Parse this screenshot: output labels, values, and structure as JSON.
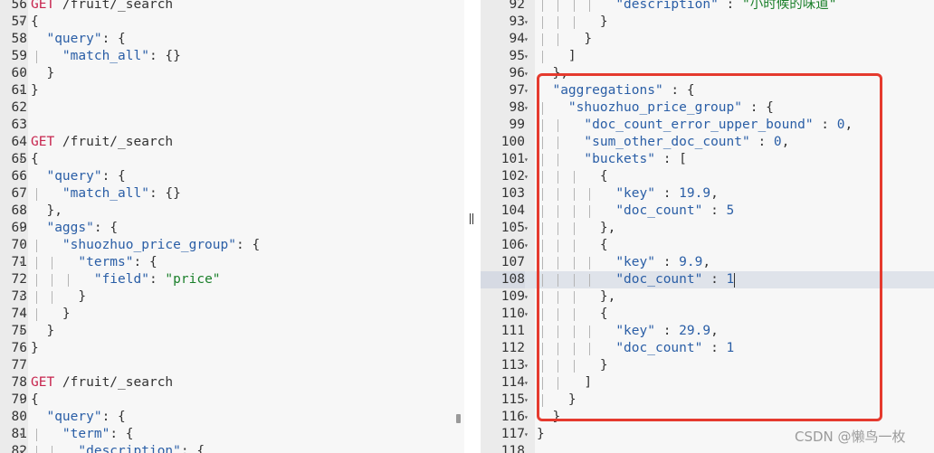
{
  "colors": {
    "annotation_box": "#e53a2e",
    "method": "#c7254e",
    "key": "#2a5ea6",
    "string": "#1a7f2a",
    "number": "#2a5ea6",
    "active_line": "#dfe3ea"
  },
  "watermark": "CSDN @懒鸟一枚",
  "left_editor": {
    "lines": [
      {
        "n": "56",
        "fold": false,
        "guides": 0,
        "tokens": [
          [
            "GET",
            "method"
          ],
          [
            " /fruit/_search",
            "path"
          ]
        ]
      },
      {
        "n": "57",
        "fold": true,
        "guides": 0,
        "tokens": [
          [
            "{",
            "punc"
          ]
        ]
      },
      {
        "n": "58",
        "fold": true,
        "guides": 0,
        "tokens": [
          [
            "  ",
            "punc"
          ],
          [
            "\"query\"",
            "key"
          ],
          [
            ": {",
            "punc"
          ]
        ]
      },
      {
        "n": "59",
        "fold": false,
        "guides": 1,
        "tokens": [
          [
            "    ",
            "punc"
          ],
          [
            "\"match_all\"",
            "key"
          ],
          [
            ": {}",
            "punc"
          ]
        ]
      },
      {
        "n": "60",
        "fold": true,
        "guides": 0,
        "tokens": [
          [
            "  }",
            "punc"
          ]
        ]
      },
      {
        "n": "61",
        "fold": true,
        "guides": 0,
        "tokens": [
          [
            "}",
            "punc"
          ]
        ]
      },
      {
        "n": "62",
        "fold": false,
        "guides": 0,
        "tokens": []
      },
      {
        "n": "63",
        "fold": false,
        "guides": 0,
        "tokens": []
      },
      {
        "n": "64",
        "fold": false,
        "guides": 0,
        "tokens": [
          [
            "GET",
            "method"
          ],
          [
            " /fruit/_search",
            "path"
          ]
        ]
      },
      {
        "n": "65",
        "fold": true,
        "guides": 0,
        "tokens": [
          [
            "{",
            "punc"
          ]
        ]
      },
      {
        "n": "66",
        "fold": true,
        "guides": 0,
        "tokens": [
          [
            "  ",
            "punc"
          ],
          [
            "\"query\"",
            "key"
          ],
          [
            ": {",
            "punc"
          ]
        ]
      },
      {
        "n": "67",
        "fold": false,
        "guides": 1,
        "tokens": [
          [
            "    ",
            "punc"
          ],
          [
            "\"match_all\"",
            "key"
          ],
          [
            ": {}",
            "punc"
          ]
        ]
      },
      {
        "n": "68",
        "fold": true,
        "guides": 0,
        "tokens": [
          [
            "  },",
            "punc"
          ]
        ]
      },
      {
        "n": "69",
        "fold": true,
        "guides": 0,
        "tokens": [
          [
            "  ",
            "punc"
          ],
          [
            "\"aggs\"",
            "key"
          ],
          [
            ": {",
            "punc"
          ]
        ]
      },
      {
        "n": "70",
        "fold": true,
        "guides": 1,
        "tokens": [
          [
            "    ",
            "punc"
          ],
          [
            "\"shuozhuo_price_group\"",
            "key"
          ],
          [
            ": {",
            "punc"
          ]
        ]
      },
      {
        "n": "71",
        "fold": true,
        "guides": 2,
        "tokens": [
          [
            "      ",
            "punc"
          ],
          [
            "\"terms\"",
            "key"
          ],
          [
            ": {",
            "punc"
          ]
        ]
      },
      {
        "n": "72",
        "fold": false,
        "guides": 3,
        "tokens": [
          [
            "        ",
            "punc"
          ],
          [
            "\"field\"",
            "key"
          ],
          [
            ": ",
            "punc"
          ],
          [
            "\"price\"",
            "str"
          ]
        ]
      },
      {
        "n": "73",
        "fold": true,
        "guides": 2,
        "tokens": [
          [
            "      }",
            "punc"
          ]
        ]
      },
      {
        "n": "74",
        "fold": true,
        "guides": 1,
        "tokens": [
          [
            "    }",
            "punc"
          ]
        ]
      },
      {
        "n": "75",
        "fold": true,
        "guides": 0,
        "tokens": [
          [
            "  }",
            "punc"
          ]
        ]
      },
      {
        "n": "76",
        "fold": true,
        "guides": 0,
        "tokens": [
          [
            "}",
            "punc"
          ]
        ]
      },
      {
        "n": "77",
        "fold": false,
        "guides": 0,
        "tokens": []
      },
      {
        "n": "78",
        "fold": false,
        "guides": 0,
        "tokens": [
          [
            "GET",
            "method"
          ],
          [
            " /fruit/_search",
            "path"
          ]
        ]
      },
      {
        "n": "79",
        "fold": true,
        "guides": 0,
        "tokens": [
          [
            "{",
            "punc"
          ]
        ]
      },
      {
        "n": "80",
        "fold": true,
        "guides": 0,
        "tokens": [
          [
            "  ",
            "punc"
          ],
          [
            "\"query\"",
            "key"
          ],
          [
            ": {",
            "punc"
          ]
        ]
      },
      {
        "n": "81",
        "fold": true,
        "guides": 1,
        "tokens": [
          [
            "    ",
            "punc"
          ],
          [
            "\"term\"",
            "key"
          ],
          [
            ": {",
            "punc"
          ]
        ]
      },
      {
        "n": "82",
        "fold": true,
        "guides": 2,
        "tokens": [
          [
            "      ",
            "punc"
          ],
          [
            "\"description\"",
            "key"
          ],
          [
            ": {",
            "punc"
          ]
        ]
      }
    ]
  },
  "right_editor": {
    "lines": [
      {
        "n": "92",
        "fold": false,
        "guides": 4,
        "tokens": [
          [
            "          ",
            "punc"
          ],
          [
            "\"description\"",
            "key"
          ],
          [
            " : ",
            "punc"
          ],
          [
            "\"小时候的味道\"",
            "str"
          ]
        ]
      },
      {
        "n": "93",
        "fold": true,
        "guides": 3,
        "tokens": [
          [
            "        }",
            "punc"
          ]
        ]
      },
      {
        "n": "94",
        "fold": true,
        "guides": 2,
        "tokens": [
          [
            "      }",
            "punc"
          ]
        ]
      },
      {
        "n": "95",
        "fold": true,
        "guides": 1,
        "tokens": [
          [
            "    ]",
            "punc"
          ]
        ]
      },
      {
        "n": "96",
        "fold": true,
        "guides": 0,
        "tokens": [
          [
            "  },",
            "punc"
          ]
        ]
      },
      {
        "n": "97",
        "fold": true,
        "guides": 0,
        "tokens": [
          [
            "  ",
            "punc"
          ],
          [
            "\"aggregations\"",
            "key"
          ],
          [
            " : {",
            "punc"
          ]
        ]
      },
      {
        "n": "98",
        "fold": true,
        "guides": 1,
        "tokens": [
          [
            "    ",
            "punc"
          ],
          [
            "\"shuozhuo_price_group\"",
            "key"
          ],
          [
            " : {",
            "punc"
          ]
        ]
      },
      {
        "n": "99",
        "fold": false,
        "guides": 2,
        "tokens": [
          [
            "      ",
            "punc"
          ],
          [
            "\"doc_count_error_upper_bound\"",
            "key"
          ],
          [
            " : ",
            "punc"
          ],
          [
            "0",
            "num"
          ],
          [
            ",",
            "punc"
          ]
        ]
      },
      {
        "n": "100",
        "fold": false,
        "guides": 2,
        "tokens": [
          [
            "      ",
            "punc"
          ],
          [
            "\"sum_other_doc_count\"",
            "key"
          ],
          [
            " : ",
            "punc"
          ],
          [
            "0",
            "num"
          ],
          [
            ",",
            "punc"
          ]
        ]
      },
      {
        "n": "101",
        "fold": true,
        "guides": 2,
        "tokens": [
          [
            "      ",
            "punc"
          ],
          [
            "\"buckets\"",
            "key"
          ],
          [
            " : [",
            "punc"
          ]
        ]
      },
      {
        "n": "102",
        "fold": true,
        "guides": 3,
        "tokens": [
          [
            "        {",
            "punc"
          ]
        ]
      },
      {
        "n": "103",
        "fold": false,
        "guides": 4,
        "tokens": [
          [
            "          ",
            "punc"
          ],
          [
            "\"key\"",
            "key"
          ],
          [
            " : ",
            "punc"
          ],
          [
            "19.9",
            "num"
          ],
          [
            ",",
            "punc"
          ]
        ]
      },
      {
        "n": "104",
        "fold": false,
        "guides": 4,
        "tokens": [
          [
            "          ",
            "punc"
          ],
          [
            "\"doc_count\"",
            "key"
          ],
          [
            " : ",
            "punc"
          ],
          [
            "5",
            "num"
          ]
        ]
      },
      {
        "n": "105",
        "fold": true,
        "guides": 3,
        "tokens": [
          [
            "        },",
            "punc"
          ]
        ]
      },
      {
        "n": "106",
        "fold": true,
        "guides": 3,
        "tokens": [
          [
            "        {",
            "punc"
          ]
        ]
      },
      {
        "n": "107",
        "fold": false,
        "guides": 4,
        "tokens": [
          [
            "          ",
            "punc"
          ],
          [
            "\"key\"",
            "key"
          ],
          [
            " : ",
            "punc"
          ],
          [
            "9.9",
            "num"
          ],
          [
            ",",
            "punc"
          ]
        ]
      },
      {
        "n": "108",
        "fold": false,
        "guides": 4,
        "active": true,
        "tokens": [
          [
            "          ",
            "punc"
          ],
          [
            "\"doc_count\"",
            "key"
          ],
          [
            " : ",
            "punc"
          ],
          [
            "1",
            "num"
          ]
        ]
      },
      {
        "n": "109",
        "fold": true,
        "guides": 3,
        "tokens": [
          [
            "        },",
            "punc"
          ]
        ]
      },
      {
        "n": "110",
        "fold": true,
        "guides": 3,
        "tokens": [
          [
            "        {",
            "punc"
          ]
        ]
      },
      {
        "n": "111",
        "fold": false,
        "guides": 4,
        "tokens": [
          [
            "          ",
            "punc"
          ],
          [
            "\"key\"",
            "key"
          ],
          [
            " : ",
            "punc"
          ],
          [
            "29.9",
            "num"
          ],
          [
            ",",
            "punc"
          ]
        ]
      },
      {
        "n": "112",
        "fold": false,
        "guides": 4,
        "tokens": [
          [
            "          ",
            "punc"
          ],
          [
            "\"doc_count\"",
            "key"
          ],
          [
            " : ",
            "punc"
          ],
          [
            "1",
            "num"
          ]
        ]
      },
      {
        "n": "113",
        "fold": true,
        "guides": 3,
        "tokens": [
          [
            "        }",
            "punc"
          ]
        ]
      },
      {
        "n": "114",
        "fold": true,
        "guides": 2,
        "tokens": [
          [
            "      ]",
            "punc"
          ]
        ]
      },
      {
        "n": "115",
        "fold": true,
        "guides": 1,
        "tokens": [
          [
            "    }",
            "punc"
          ]
        ]
      },
      {
        "n": "116",
        "fold": true,
        "guides": 0,
        "tokens": [
          [
            "  }",
            "punc"
          ]
        ]
      },
      {
        "n": "117",
        "fold": true,
        "guides": 0,
        "tokens": [
          [
            "}",
            "punc"
          ]
        ]
      },
      {
        "n": "118",
        "fold": false,
        "guides": 0,
        "tokens": []
      }
    ]
  }
}
